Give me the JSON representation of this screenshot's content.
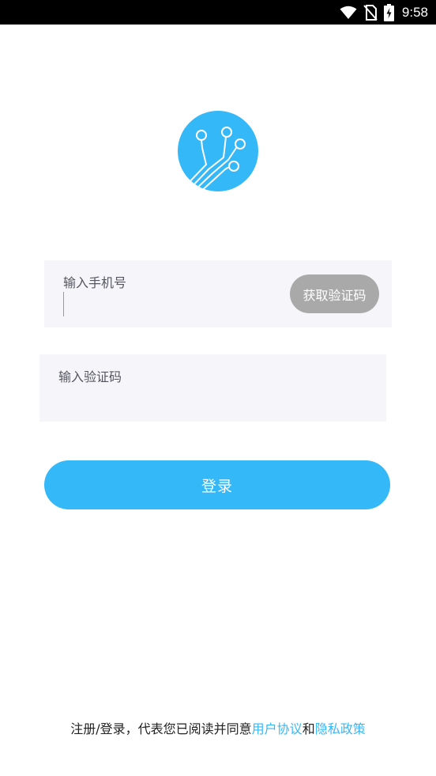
{
  "status_bar": {
    "time": "9:58",
    "icons": [
      "wifi-icon",
      "no-sim-icon",
      "battery-charging-icon"
    ]
  },
  "logo": {
    "icon": "circuit-logo-icon",
    "color": "#35b8f8"
  },
  "form": {
    "phone_placeholder": "输入手机号",
    "get_code_label": "获取验证码",
    "code_placeholder": "输入验证码",
    "login_label": "登录"
  },
  "agreement": {
    "prefix": "注册/登录，代表您已阅读并同意",
    "user_agreement": "用户协议",
    "conjunction": "和",
    "privacy_policy": "隐私政策"
  },
  "colors": {
    "accent": "#35b8f8",
    "disabled_button": "#a9a9a9",
    "field_background": "#f6f6fa"
  }
}
